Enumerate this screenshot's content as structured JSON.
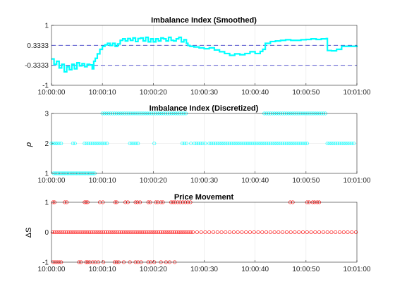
{
  "chart_data": [
    {
      "type": "line",
      "title": "Imbalance Index (Smoothed)",
      "xlabel": "",
      "ylabel": "",
      "xlim": [
        "10:00:00",
        "10:01:00"
      ],
      "ylim": [
        -1,
        1
      ],
      "x_ticks": [
        "10:00:00",
        "10:00:10",
        "10:00:20",
        "10:00:30",
        "10:00:40",
        "10:00:50",
        "10:01:00"
      ],
      "y_ticks": [
        {
          "value": -1,
          "label": "-1"
        },
        {
          "value": -0.3333,
          "label": "-0.3333"
        },
        {
          "value": 0.3333,
          "label": "0.3333"
        },
        {
          "value": 1,
          "label": "1"
        }
      ],
      "reference_lines": [
        -0.3333,
        0.3333
      ],
      "grid": true,
      "series": [
        {
          "color": "#00ffff",
          "x": [
            0,
            0.5,
            1,
            1.5,
            2,
            2.5,
            3,
            3.5,
            4,
            4.5,
            5,
            5.5,
            6,
            6.5,
            7,
            7.5,
            8,
            8.3,
            8.6,
            9,
            9.5,
            10,
            10.5,
            11,
            11.5,
            12,
            12.5,
            13,
            13.5,
            14,
            14.5,
            15,
            15.5,
            16,
            16.5,
            17,
            17.5,
            18,
            18.5,
            19,
            19.5,
            20,
            20.5,
            21,
            21.5,
            22,
            22.5,
            23,
            23.5,
            24,
            24.5,
            25,
            25.5,
            26,
            26.5,
            26.8,
            27.2,
            28,
            29,
            30,
            31,
            32,
            33,
            34,
            35,
            36,
            37,
            38,
            39,
            40,
            41,
            41.5,
            42,
            43,
            44,
            45,
            46,
            47,
            48,
            49,
            50,
            51,
            52,
            53,
            54,
            54.2,
            55,
            56,
            57,
            58,
            59,
            60
          ],
          "y": [
            -0.12,
            -0.3,
            -0.2,
            -0.42,
            -0.3,
            -0.55,
            -0.38,
            -0.48,
            -0.3,
            -0.45,
            -0.25,
            -0.35,
            -0.28,
            -0.38,
            -0.3,
            -0.32,
            -0.45,
            -0.2,
            -0.1,
            0.05,
            0.2,
            0.3,
            0.35,
            0.4,
            0.33,
            0.4,
            0.3,
            0.38,
            0.5,
            0.55,
            0.48,
            0.56,
            0.5,
            0.58,
            0.46,
            0.56,
            0.58,
            0.48,
            0.6,
            0.45,
            0.55,
            0.45,
            0.55,
            0.48,
            0.58,
            0.55,
            0.48,
            0.6,
            0.5,
            0.48,
            0.55,
            0.6,
            0.45,
            0.52,
            0.4,
            0.33,
            0.3,
            0.28,
            0.25,
            0.22,
            0.25,
            0.18,
            0.12,
            0.06,
            0.0,
            0.05,
            0.02,
            0.06,
            0.12,
            0.06,
            0.13,
            0.2,
            0.4,
            0.46,
            0.48,
            0.5,
            0.52,
            0.5,
            0.5,
            0.52,
            0.53,
            0.55,
            0.53,
            0.55,
            0.56,
            0.16,
            0.15,
            0.2,
            0.3,
            0.3,
            0.3,
            0.33
          ]
        }
      ]
    },
    {
      "type": "scatter",
      "title": "Imbalance Index (Discretized)",
      "xlabel": "",
      "ylabel": "ρ",
      "xlim": [
        "10:00:00",
        "10:01:00"
      ],
      "ylim": [
        1,
        3
      ],
      "x_ticks": [
        "10:00:00",
        "10:00:10",
        "10:00:20",
        "10:00:30",
        "10:00:40",
        "10:00:50",
        "10:01:00"
      ],
      "y_ticks": [
        {
          "value": 1,
          "label": "1"
        },
        {
          "value": 2,
          "label": "2"
        },
        {
          "value": 3,
          "label": "3"
        }
      ],
      "grid": true,
      "series": [
        {
          "color": "#00ffff",
          "x": [
            0,
            0.4,
            0.8,
            1.1,
            1.5,
            1.9,
            4.2,
            4.6,
            6.5,
            6.9,
            7.3,
            7.7,
            8.1,
            8.5,
            8.9,
            9.3,
            9.7,
            10.1,
            10.5,
            10.9,
            15.4,
            15.8,
            16.2,
            16.6,
            17.0,
            20.2,
            25.7,
            26.1,
            26.5,
            27.4,
            28.1,
            28.5,
            28.9,
            29.3,
            29.7,
            30.2,
            31.0,
            31.4,
            31.8,
            32.2,
            32.6,
            33.0,
            33.4,
            33.8,
            34.2,
            34.6,
            35.0,
            35.4,
            35.8,
            36.2,
            36.6,
            37.0,
            37.4,
            37.8,
            38.2,
            38.6,
            39.0,
            39.4,
            39.8,
            40.2,
            40.6,
            41.0,
            41.4,
            41.8,
            42.2,
            42.6,
            43.0,
            43.4,
            43.8,
            44.2,
            44.6,
            45.0,
            45.4,
            45.8,
            46.2,
            46.6,
            47.0,
            47.4,
            47.8,
            48.2,
            48.6,
            49.0,
            49.4,
            49.8,
            50.2,
            54.2,
            54.6,
            55.0,
            55.4,
            55.8,
            56.2,
            56.6,
            57.0,
            57.4,
            57.8,
            58.2,
            58.6,
            59.0,
            59.4
          ],
          "y": [
            2,
            2,
            2,
            2,
            2,
            2,
            2,
            2,
            2,
            2,
            2,
            2,
            2,
            2,
            2,
            2,
            2,
            2,
            2,
            2,
            2,
            2,
            2,
            2,
            2,
            2,
            2,
            2,
            2,
            2,
            2,
            2,
            2,
            2,
            2,
            2,
            2,
            2,
            2,
            2,
            2,
            2,
            2,
            2,
            2,
            2,
            2,
            2,
            2,
            2,
            2,
            2,
            2,
            2,
            2,
            2,
            2,
            2,
            2,
            2,
            2,
            2,
            2,
            2,
            2,
            2,
            2,
            2,
            2,
            2,
            2,
            2,
            2,
            2,
            2,
            2,
            2,
            2,
            2,
            2,
            2,
            2,
            2,
            2,
            2,
            2,
            2,
            2,
            2,
            2,
            2,
            2,
            2,
            2,
            2,
            2,
            2,
            2,
            2
          ]
        },
        {
          "color": "#00ffff",
          "x": [
            0.4,
            0.7,
            1.0,
            1.3,
            1.6,
            1.9,
            2.2,
            2.5,
            2.8,
            3.1,
            3.4,
            3.7,
            4.0,
            4.3,
            4.6,
            4.9,
            5.2,
            5.5,
            5.8,
            6.1,
            6.4,
            6.7,
            7.0,
            7.3,
            7.6,
            7.9,
            8.2,
            8.5
          ],
          "y": [
            1,
            1,
            1,
            1,
            1,
            1,
            1,
            1,
            1,
            1,
            1,
            1,
            1,
            1,
            1,
            1,
            1,
            1,
            1,
            1,
            1,
            1,
            1,
            1,
            1,
            1,
            1,
            1
          ]
        },
        {
          "color": "#00ffff",
          "x": [
            10.0,
            10.4,
            10.8,
            11.2,
            11.6,
            12.0,
            12.4,
            12.8,
            13.2,
            13.6,
            14.0,
            14.4,
            14.8,
            15.2,
            15.6,
            16.0,
            16.4,
            16.8,
            17.2,
            17.6,
            18.0,
            18.4,
            18.8,
            19.2,
            19.6,
            20.0,
            20.4,
            20.8,
            21.2,
            21.6,
            22.0,
            22.4,
            22.8,
            23.2,
            23.6,
            24.0,
            24.4,
            24.8,
            25.2,
            25.6,
            26.0,
            26.4,
            41.8,
            42.2,
            42.6,
            43.0,
            43.4,
            43.8,
            44.2,
            44.6,
            45.0,
            45.4,
            45.8,
            46.2,
            46.6,
            47.0,
            47.4,
            47.8,
            48.2,
            48.6,
            49.0,
            49.4,
            49.8,
            50.2,
            50.6,
            51.0,
            51.4,
            51.8,
            52.2,
            52.6,
            53.0,
            53.4,
            53.8
          ],
          "y": [
            3,
            3,
            3,
            3,
            3,
            3,
            3,
            3,
            3,
            3,
            3,
            3,
            3,
            3,
            3,
            3,
            3,
            3,
            3,
            3,
            3,
            3,
            3,
            3,
            3,
            3,
            3,
            3,
            3,
            3,
            3,
            3,
            3,
            3,
            3,
            3,
            3,
            3,
            3,
            3,
            3,
            3,
            3,
            3,
            3,
            3,
            3,
            3,
            3,
            3,
            3,
            3,
            3,
            3,
            3,
            3,
            3,
            3,
            3,
            3,
            3,
            3,
            3,
            3,
            3,
            3,
            3,
            3,
            3,
            3,
            3,
            3,
            3
          ]
        }
      ]
    },
    {
      "type": "scatter",
      "title": "Price Movement",
      "xlabel": "",
      "ylabel": "ΔS",
      "xlim": [
        "10:00:00",
        "10:01:00"
      ],
      "ylim": [
        -1,
        1
      ],
      "x_ticks": [
        "10:00:00",
        "10:00:10",
        "10:00:20",
        "10:00:30",
        "10:00:40",
        "10:00:50",
        "10:01:00"
      ],
      "y_ticks": [
        {
          "value": -1,
          "label": "-1"
        },
        {
          "value": 0,
          "label": "0"
        },
        {
          "value": 1,
          "label": "1"
        }
      ],
      "grid": true,
      "series": [
        {
          "color": "#ff0000",
          "x": [
            0.2,
            0.6,
            1.0,
            1.4,
            1.8,
            2.2,
            2.6,
            3.0,
            3.4,
            3.8,
            4.2,
            4.6,
            5.0,
            5.4,
            5.8,
            6.2,
            6.6,
            7.0,
            7.4,
            7.8,
            8.2,
            8.6,
            9.0,
            9.4,
            9.8,
            10.2,
            10.6,
            11.0,
            11.4,
            11.8,
            12.2,
            12.6,
            13.0,
            13.4,
            13.8,
            14.2,
            14.6,
            15.0,
            15.4,
            15.8,
            16.2,
            16.6,
            17.0,
            17.4,
            17.8,
            18.2,
            18.6,
            19.0,
            19.4,
            19.8,
            20.2,
            20.6,
            21.0,
            21.4,
            21.8,
            22.2,
            22.6,
            23.0,
            23.4,
            23.8,
            24.2,
            24.6,
            25.0,
            25.4,
            25.8,
            26.2,
            26.6,
            27.0,
            27.4,
            27.8,
            28.6,
            29.4,
            30.2,
            31.0,
            31.8,
            32.6,
            33.4,
            34.2,
            35.0,
            35.8,
            36.6,
            37.4,
            38.2,
            39.0,
            39.8,
            40.6,
            41.4,
            42.2,
            43.0,
            43.8,
            44.6,
            45.4,
            46.2,
            47.0,
            47.8,
            48.6,
            49.4,
            50.2,
            51.0,
            51.8,
            52.6,
            53.4,
            54.2,
            55.0,
            55.8,
            56.6,
            57.4,
            58.2,
            59.0,
            59.8
          ],
          "y": [
            0,
            0,
            0,
            0,
            0,
            0,
            0,
            0,
            0,
            0,
            0,
            0,
            0,
            0,
            0,
            0,
            0,
            0,
            0,
            0,
            0,
            0,
            0,
            0,
            0,
            0,
            0,
            0,
            0,
            0,
            0,
            0,
            0,
            0,
            0,
            0,
            0,
            0,
            0,
            0,
            0,
            0,
            0,
            0,
            0,
            0,
            0,
            0,
            0,
            0,
            0,
            0,
            0,
            0,
            0,
            0,
            0,
            0,
            0,
            0,
            0,
            0,
            0,
            0,
            0,
            0,
            0,
            0,
            0,
            0,
            0,
            0,
            0,
            0,
            0,
            0,
            0,
            0,
            0,
            0,
            0,
            0,
            0,
            0,
            0,
            0,
            0,
            0,
            0,
            0,
            0,
            0,
            0,
            0,
            0,
            0,
            0,
            0,
            0,
            0,
            0,
            0,
            0,
            0,
            0,
            0,
            0,
            0,
            0,
            0
          ]
        },
        {
          "color": "#ff0000",
          "x": [
            0.3,
            0.6,
            2.6,
            3.0,
            6.5,
            6.8,
            7.1,
            9.5,
            10.1,
            12.5,
            12.8,
            14.5,
            15.0,
            16.5,
            16.9,
            17.4,
            19.0,
            19.4,
            20.5,
            20.9,
            21.5,
            21.9,
            23.5,
            23.9,
            24.3,
            24.8,
            25.3,
            25.8,
            26.3,
            26.8,
            27.3,
            46.9,
            47.4,
            50.2,
            50.6,
            51.3,
            51.7,
            52.2,
            52.6
          ],
          "y": [
            1,
            1,
            1,
            1,
            1,
            1,
            1,
            1,
            1,
            1,
            1,
            1,
            1,
            1,
            1,
            1,
            1,
            1,
            1,
            1,
            1,
            1,
            1,
            1,
            1,
            1,
            1,
            1,
            1,
            1,
            1,
            1,
            1,
            1,
            1,
            1,
            1,
            1,
            1
          ]
        },
        {
          "color": "#ff0000",
          "x": [
            0.3,
            0.7,
            1.1,
            1.5,
            1.9,
            5.4,
            5.8,
            6.8,
            7.1,
            7.5,
            8.1,
            8.6,
            9.2,
            10.2,
            12.4,
            12.8,
            13.2,
            14.2,
            15.4,
            16.5,
            17.0,
            17.6,
            19.0,
            19.5,
            20.2,
            21.5,
            22.5,
            23.2,
            24.2
          ],
          "y": [
            -1,
            -1,
            -1,
            -1,
            -1,
            -1,
            -1,
            -1,
            -1,
            -1,
            -1,
            -1,
            -1,
            -1,
            -1,
            -1,
            -1,
            -1,
            -1,
            -1,
            -1,
            -1,
            -1,
            -1,
            -1,
            -1,
            -1,
            -1,
            -1
          ]
        }
      ]
    }
  ]
}
